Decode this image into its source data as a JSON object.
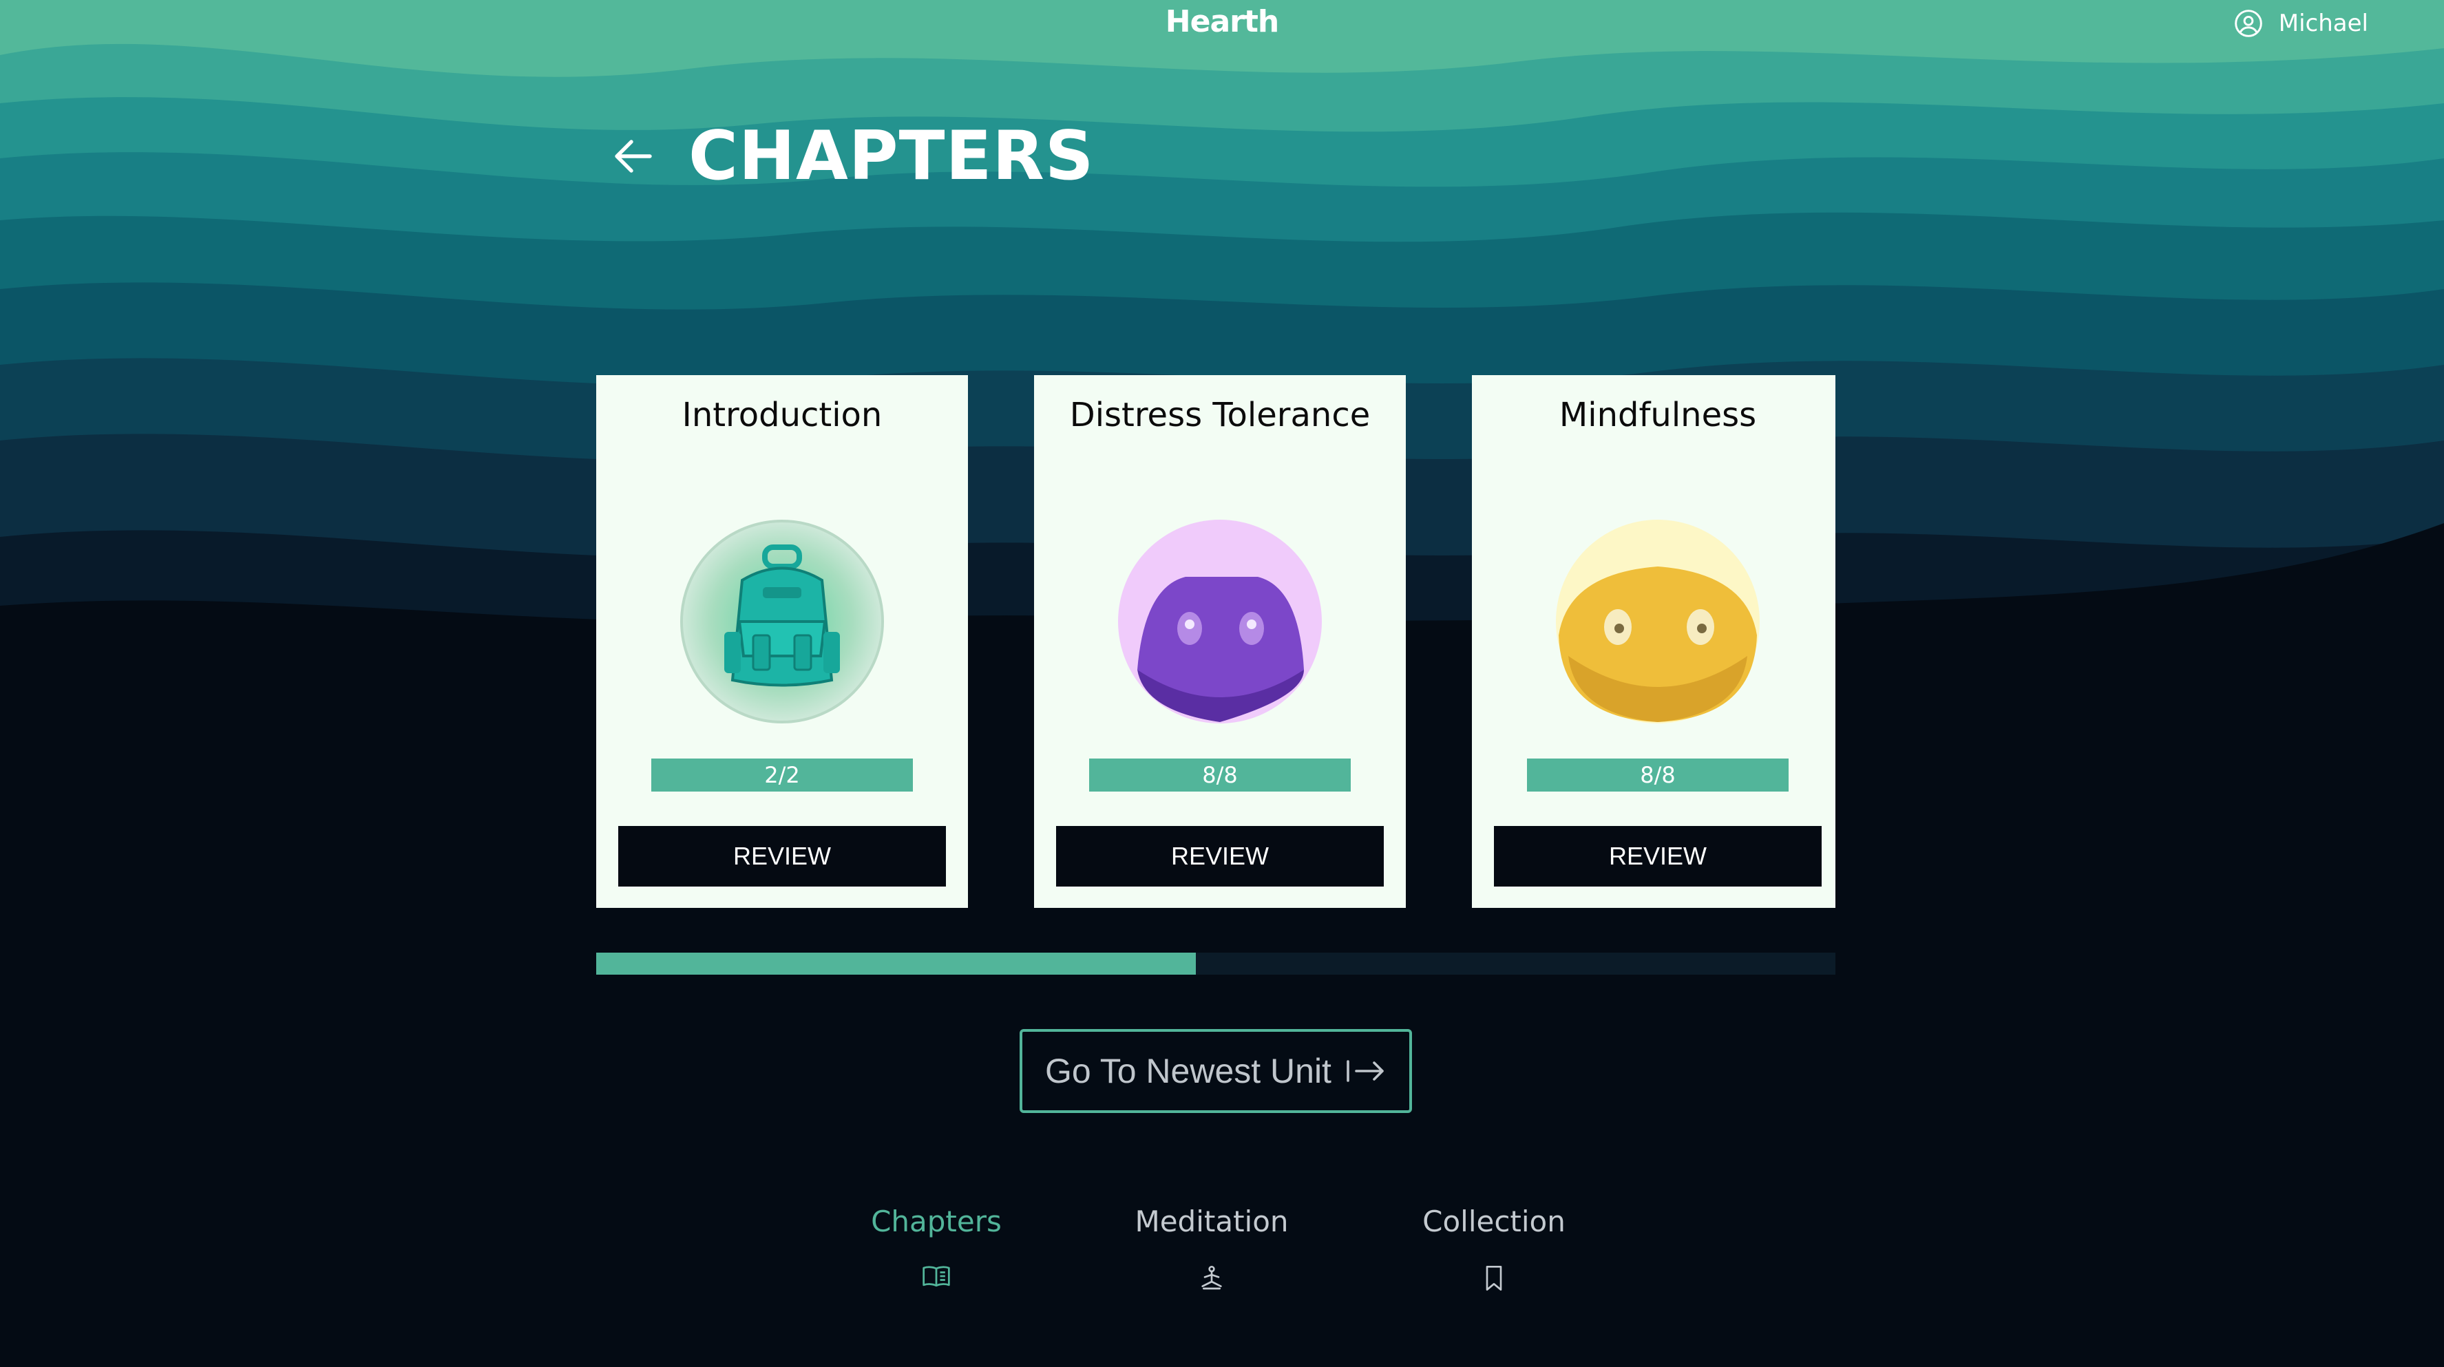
{
  "app": {
    "brand": "Hearth"
  },
  "user": {
    "name": "Michael",
    "icon": "user-circle-icon"
  },
  "page": {
    "title": "CHAPTERS",
    "back_icon": "arrow-left-icon"
  },
  "colors": {
    "accent": "#52b59a",
    "card": "#f3fdf4",
    "button": "#050a12",
    "background": "#040b14"
  },
  "cards": [
    {
      "title": "Introduction",
      "progress": "2/2",
      "progress_fraction": 1.0,
      "button": "REVIEW",
      "image": "backpack-icon"
    },
    {
      "title": "Distress Tolerance",
      "progress": "8/8",
      "progress_fraction": 1.0,
      "button": "REVIEW",
      "image": "purple-blob-icon"
    },
    {
      "title": "Mindfulness",
      "progress": "8/8",
      "progress_fraction": 1.0,
      "button": "REVIEW",
      "image": "yellow-blob-icon"
    }
  ],
  "carousel": {
    "scroll_fraction": 0.484
  },
  "cta": {
    "label": "Go To Newest Unit",
    "icon": "arrow-right-to-bar-icon"
  },
  "nav": {
    "items": [
      {
        "label": "Chapters",
        "icon": "book-open-icon",
        "active": true
      },
      {
        "label": "Meditation",
        "icon": "meditation-icon",
        "active": false
      },
      {
        "label": "Collection",
        "icon": "bookmark-icon",
        "active": false
      }
    ]
  }
}
